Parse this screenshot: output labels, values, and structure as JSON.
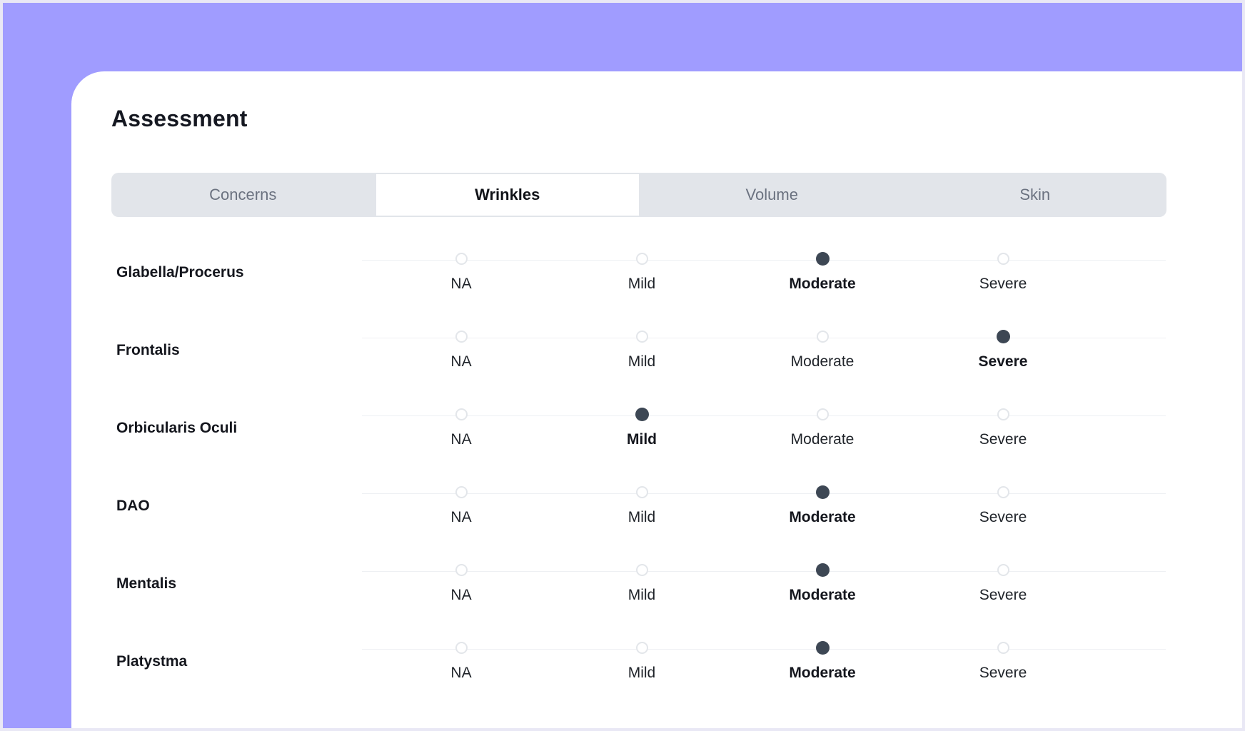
{
  "colors": {
    "backdrop": "#a09cff",
    "card": "#ffffff",
    "tab_bar": "#e2e5ea",
    "selected_radio": "#3d4754"
  },
  "page": {
    "title": "Assessment"
  },
  "tabs": [
    {
      "label": "Concerns",
      "active": false
    },
    {
      "label": "Wrinkles",
      "active": true
    },
    {
      "label": "Volume",
      "active": false
    },
    {
      "label": "Skin",
      "active": false
    }
  ],
  "options": [
    "NA",
    "Mild",
    "Moderate",
    "Severe"
  ],
  "rows": [
    {
      "label": "Glabella/Procerus",
      "selected": "Moderate"
    },
    {
      "label": "Frontalis",
      "selected": "Severe"
    },
    {
      "label": "Orbicularis Oculi",
      "selected": "Mild"
    },
    {
      "label": "DAO",
      "selected": "Moderate"
    },
    {
      "label": "Mentalis",
      "selected": "Moderate"
    },
    {
      "label": "Platystma",
      "selected": "Moderate"
    }
  ]
}
